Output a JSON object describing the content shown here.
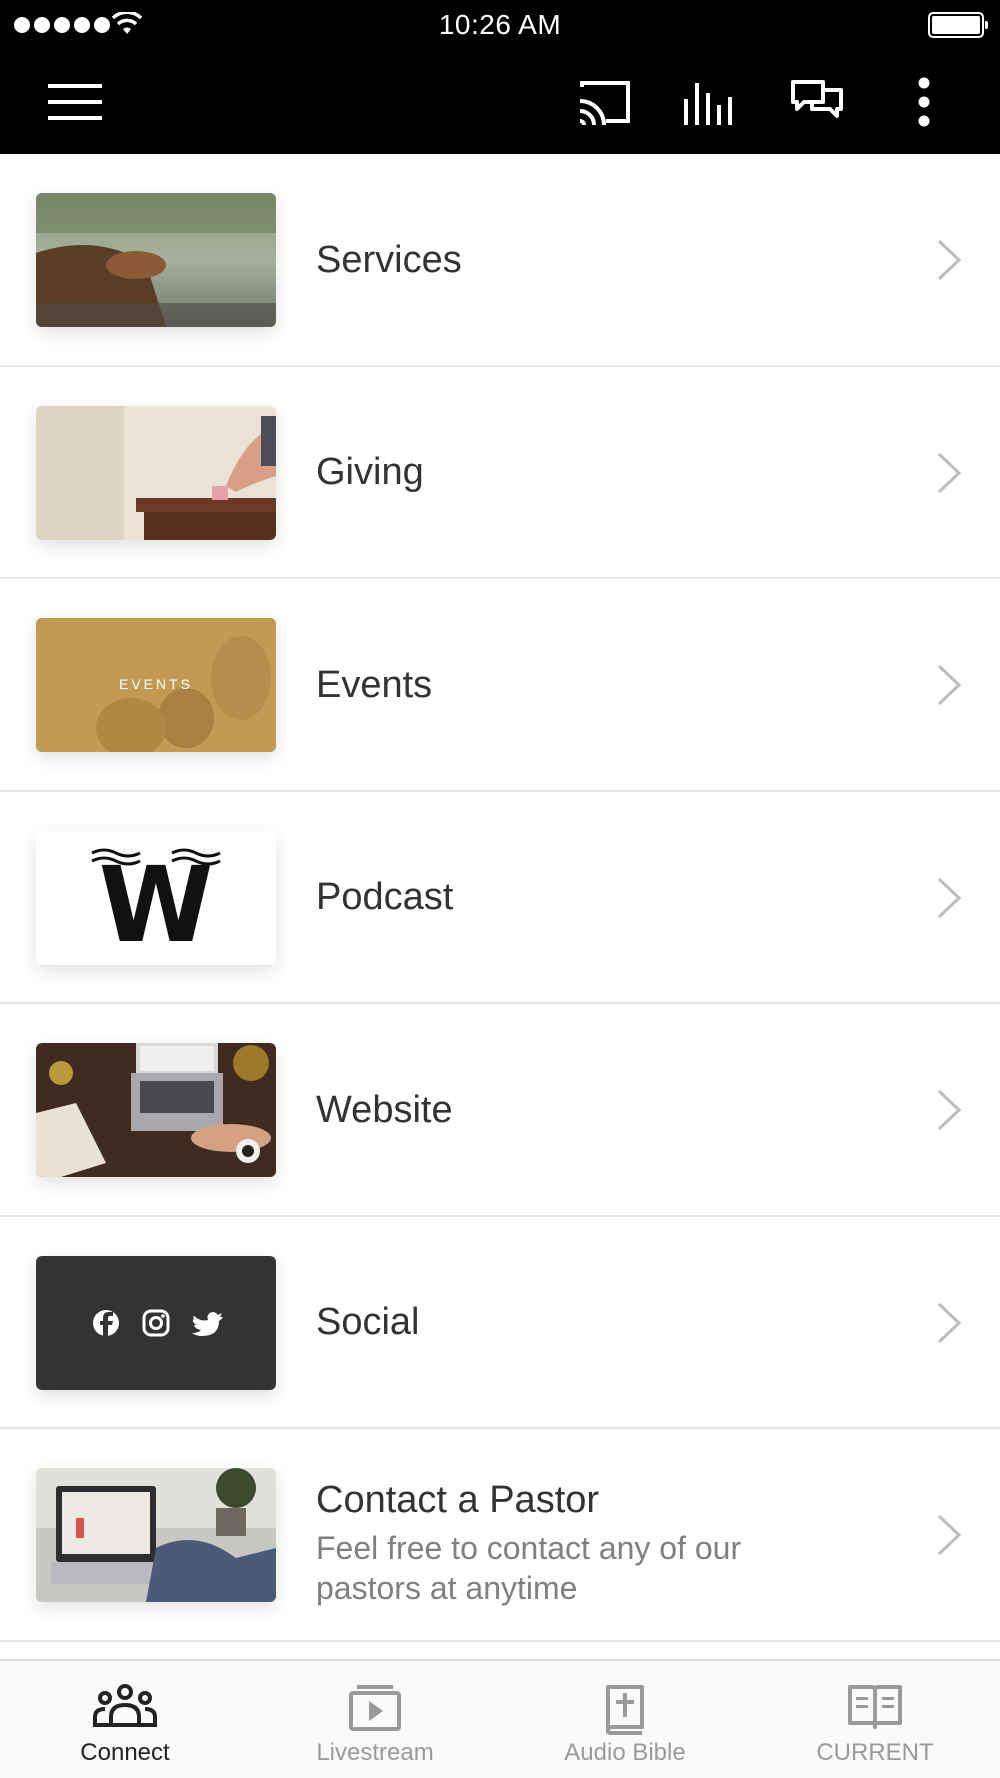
{
  "status_bar": {
    "time": "10:26 AM",
    "signal_icon": "signal-dots-icon",
    "wifi_icon": "wifi-icon",
    "battery_icon": "battery-icon",
    "battery_level": 1.0
  },
  "toolbar": {
    "menu_icon": "hamburger-menu-icon",
    "cast_icon": "cast-icon",
    "audio_icon": "audio-bars-icon",
    "chat_icon": "chat-bubbles-icon",
    "more_icon": "more-vertical-icon"
  },
  "list": {
    "items": [
      {
        "title": "Services",
        "thumb": "services-thumbnail"
      },
      {
        "title": "Giving",
        "thumb": "giving-thumbnail"
      },
      {
        "title": "Events",
        "thumb": "events-thumbnail",
        "thumb_text": "EVENTS"
      },
      {
        "title": "Podcast",
        "thumb": "podcast-logo-thumbnail",
        "thumb_text": "W"
      },
      {
        "title": "Website",
        "thumb": "website-thumbnail"
      },
      {
        "title": "Social",
        "thumb": "social-thumbnail"
      },
      {
        "title": "Contact a Pastor",
        "subtitle": "Feel free to contact any of our pastors at anytime",
        "thumb": "contact-pastor-thumbnail"
      }
    ]
  },
  "tabbar": {
    "tabs": [
      {
        "label": "Connect",
        "icon": "people-group-icon",
        "active": true
      },
      {
        "label": "Livestream",
        "icon": "play-video-icon",
        "active": false
      },
      {
        "label": "Audio Bible",
        "icon": "bible-cross-icon",
        "active": false
      },
      {
        "label": "CURRENT",
        "icon": "open-book-icon",
        "active": false
      }
    ]
  },
  "colors": {
    "header_bg": "#000000",
    "text": "#333333",
    "subtitle": "#808080",
    "tab_inactive": "#9a9a9a",
    "tab_active": "#222222",
    "divider": "#e6e6e6"
  }
}
